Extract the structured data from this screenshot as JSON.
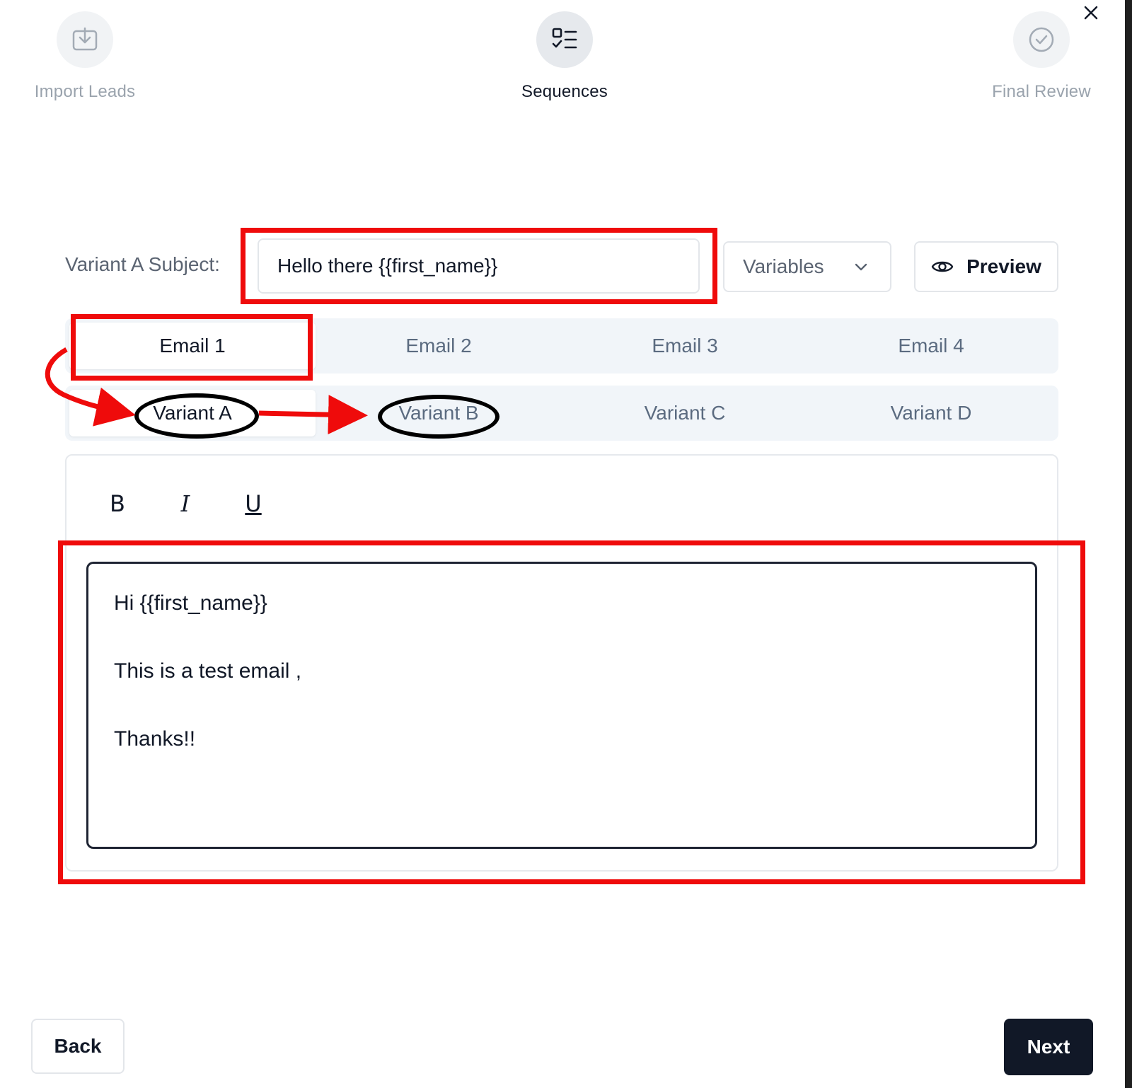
{
  "stepper": {
    "steps": [
      {
        "label": "Import Leads",
        "icon": "import-icon",
        "state": "inactive"
      },
      {
        "label": "Sequences",
        "icon": "sequences-icon",
        "state": "active"
      },
      {
        "label": "Final Review",
        "icon": "check-circle-icon",
        "state": "inactive"
      }
    ]
  },
  "subject": {
    "label": "Variant A Subject:",
    "value": "Hello there {{first_name}}"
  },
  "variables": {
    "label": "Variables"
  },
  "preview": {
    "label": "Preview"
  },
  "email_tabs": [
    "Email 1",
    "Email 2",
    "Email 3",
    "Email 4"
  ],
  "selected_email_tab": "Email 1",
  "variant_tabs": [
    "Variant A",
    "Variant B",
    "Variant C",
    "Variant D"
  ],
  "selected_variant_tab": "Variant A",
  "toolbar": {
    "bold": "B",
    "italic": "I",
    "underline": "U"
  },
  "editor": {
    "lines": [
      "Hi {{first_name}}",
      "This is a test email ,",
      "Thanks!!"
    ]
  },
  "footer": {
    "back_label": "Back",
    "next_label": "Next"
  },
  "colors": {
    "accent_dark": "#111827",
    "annotation_red": "#ef0b0b",
    "tab_bg": "#f1f5f9"
  }
}
